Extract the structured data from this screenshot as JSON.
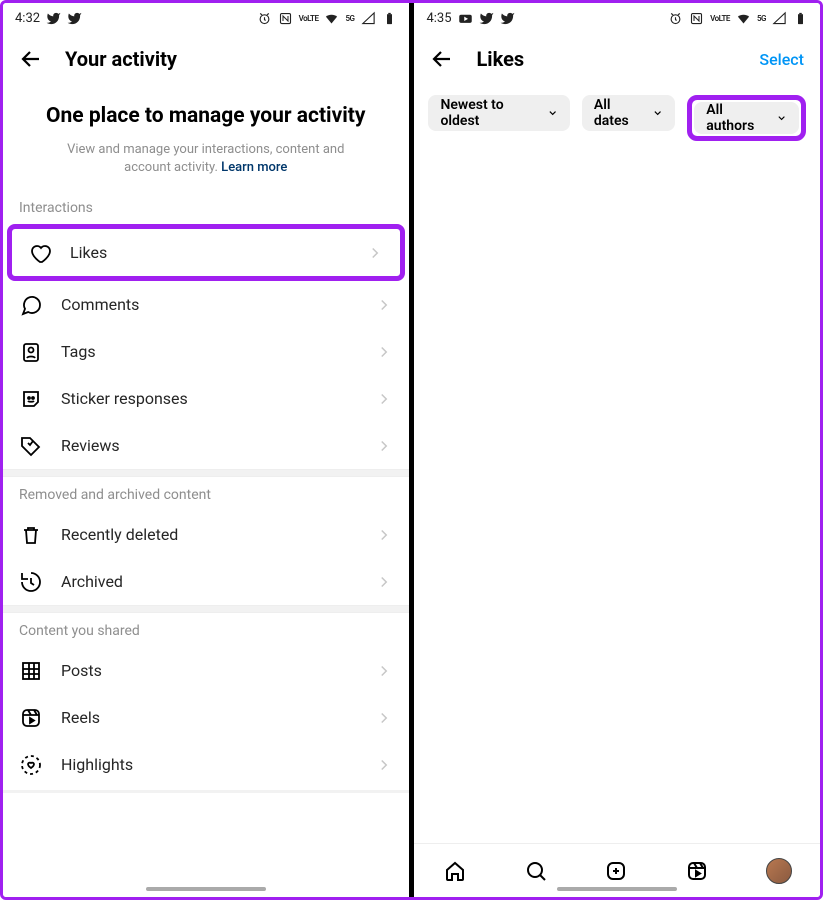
{
  "left": {
    "status": {
      "time": "4:32",
      "net": "5G",
      "lte": "VoLTE"
    },
    "header": {
      "title": "Your activity"
    },
    "hero": "One place to manage your activity",
    "sub_a": "View and manage your interactions, content and account activity. ",
    "sub_link": "Learn more",
    "sections": {
      "interactions": {
        "label": "Interactions",
        "items": [
          "Likes",
          "Comments",
          "Tags",
          "Sticker responses",
          "Reviews"
        ]
      },
      "removed": {
        "label": "Removed and archived content",
        "items": [
          "Recently deleted",
          "Archived"
        ]
      },
      "shared": {
        "label": "Content you shared",
        "items": [
          "Posts",
          "Reels",
          "Highlights"
        ]
      }
    }
  },
  "right": {
    "status": {
      "time": "4:35",
      "net": "5G",
      "lte": "VoLTE"
    },
    "header": {
      "title": "Likes",
      "action": "Select"
    },
    "chips": [
      "Newest to oldest",
      "All dates",
      "All authors"
    ]
  }
}
